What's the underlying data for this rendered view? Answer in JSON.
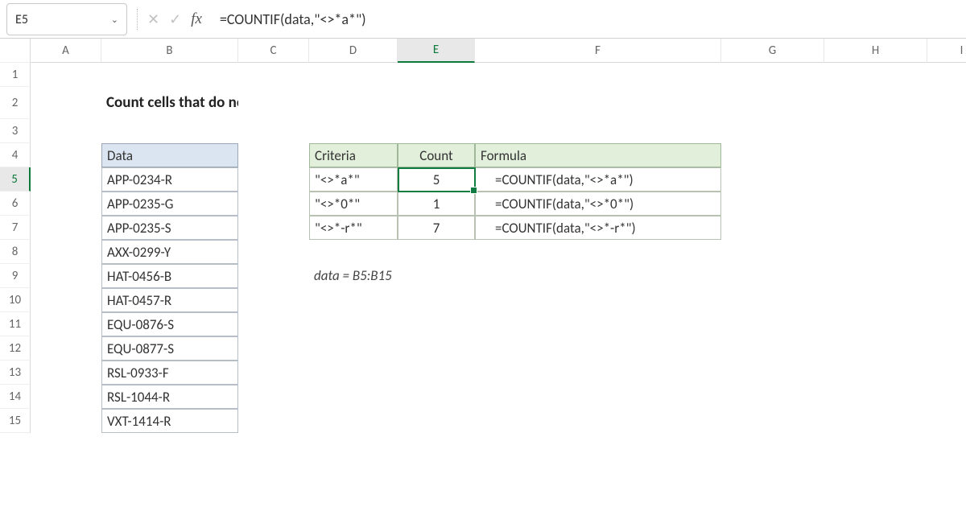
{
  "namebox": {
    "value": "E5"
  },
  "formula_bar": "=COUNTIF(data,\"<>*a*\")",
  "columns": [
    "A",
    "B",
    "C",
    "D",
    "E",
    "F",
    "G",
    "H",
    "I"
  ],
  "rows": [
    "1",
    "2",
    "3",
    "4",
    "5",
    "6",
    "7",
    "8",
    "9",
    "10",
    "11",
    "12",
    "13",
    "14",
    "15"
  ],
  "selected": {
    "col": "E",
    "row": "5"
  },
  "title": "Count cells that do not contain",
  "data_header": "Data",
  "data_values": [
    "APP-0234-R",
    "APP-0235-G",
    "APP-0235-S",
    "AXX-0299-Y",
    "HAT-0456-B",
    "HAT-0457-R",
    "EQU-0876-S",
    "EQU-0877-S",
    "RSL-0933-F",
    "RSL-1044-R",
    "VXT-1414-R"
  ],
  "result_headers": {
    "criteria": "Criteria",
    "count": "Count",
    "formula": "Formula"
  },
  "results": [
    {
      "criteria": "\"<>*a*\"",
      "count": "5",
      "formula": "=COUNTIF(data,\"<>*a*\")"
    },
    {
      "criteria": "\"<>*0*\"",
      "count": "1",
      "formula": "=COUNTIF(data,\"<>*0*\")"
    },
    {
      "criteria": "\"<>*-r*\"",
      "count": "7",
      "formula": "=COUNTIF(data,\"<>*-r*\")"
    }
  ],
  "note": "data = B5:B15",
  "icons": {
    "dropdown": "⌄",
    "cancel": "✕",
    "confirm": "✓"
  }
}
